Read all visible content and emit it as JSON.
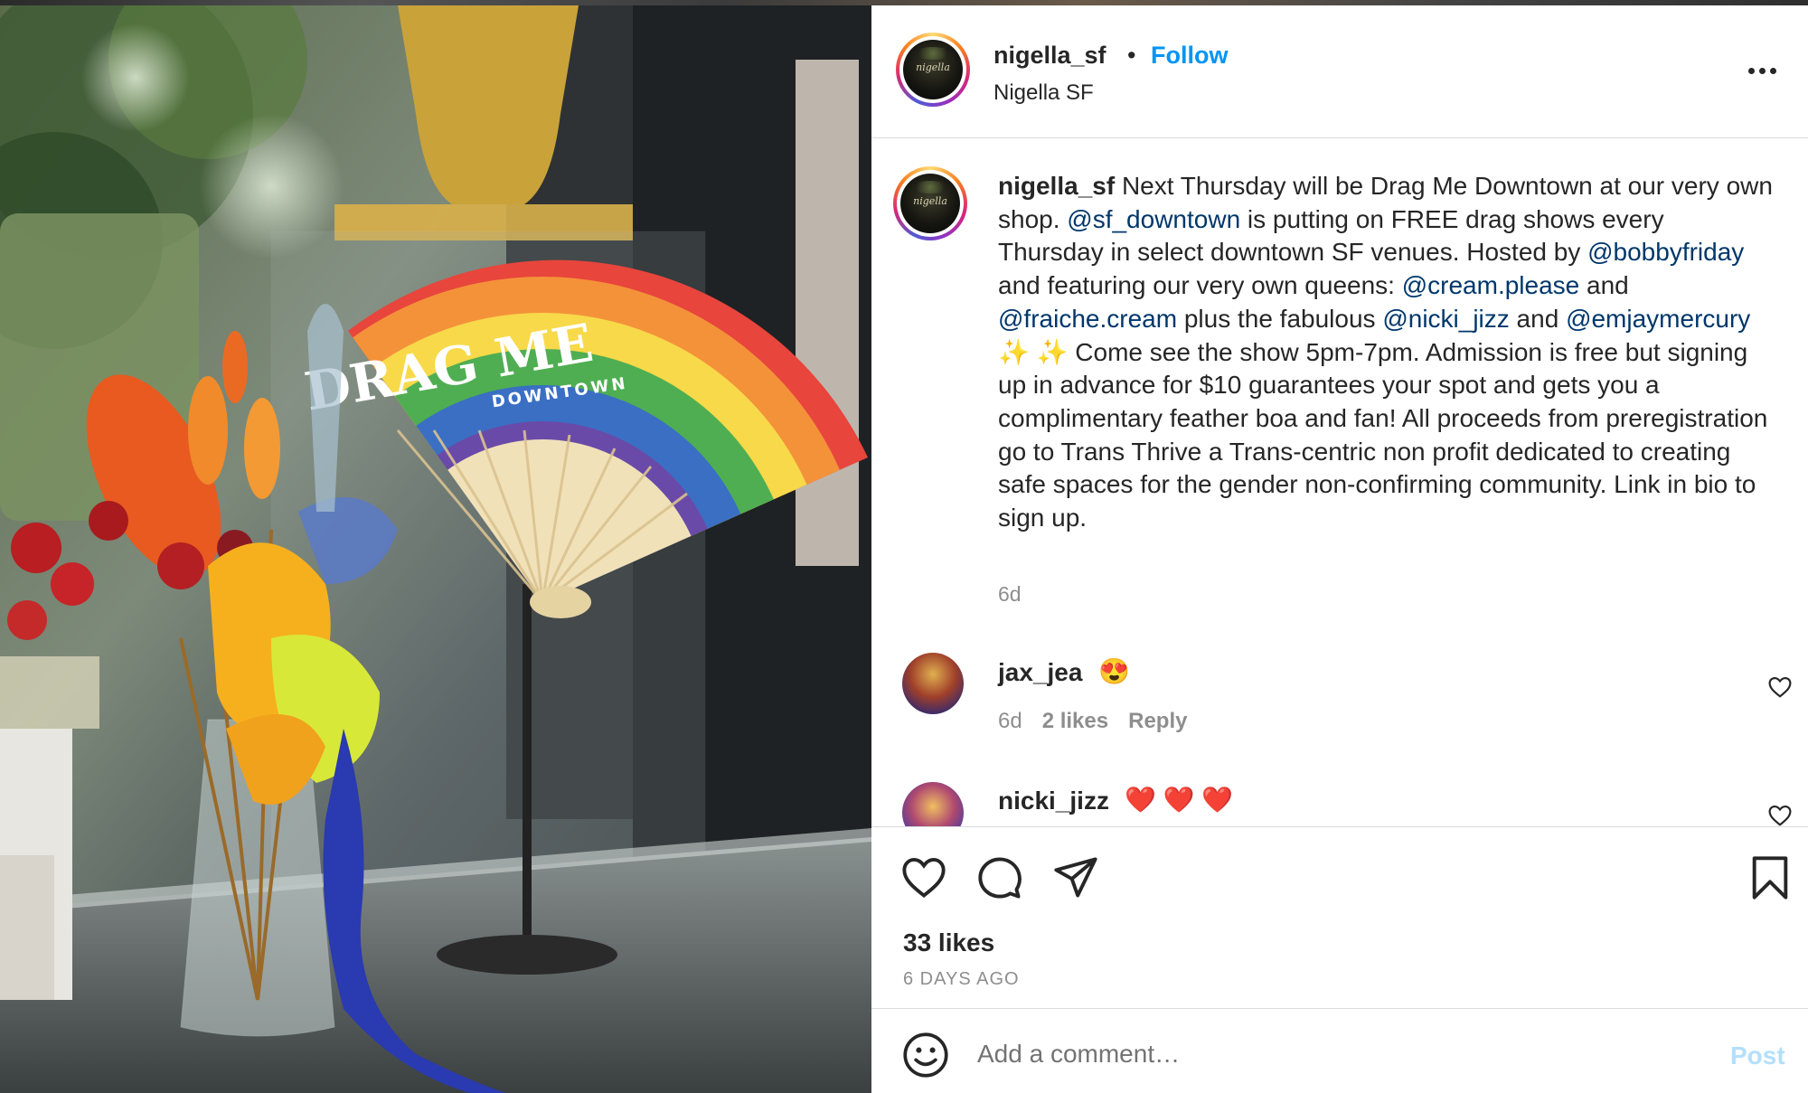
{
  "post": {
    "username": "nigella_sf",
    "follow_label": "Follow",
    "dot": "•",
    "subtitle": "Nigella SF",
    "avatar_text": "nigella"
  },
  "caption": {
    "username": "nigella_sf",
    "parts": [
      {
        "t": " Next Thursday will be Drag Me Downtown at our very own shop. ",
        "m": false
      },
      {
        "t": "@sf_downtown",
        "m": true
      },
      {
        "t": " is putting on FREE drag shows every Thursday in select downtown SF venues. Hosted by ",
        "m": false
      },
      {
        "t": "@bobbyfriday",
        "m": true
      },
      {
        "t": " and featuring our very own queens: ",
        "m": false
      },
      {
        "t": "@cream.please",
        "m": true
      },
      {
        "t": " and ",
        "m": false
      },
      {
        "t": "@fraiche.cream",
        "m": true
      },
      {
        "t": " plus the fabulous ",
        "m": false
      },
      {
        "t": "@nicki_jizz",
        "m": true
      },
      {
        "t": " and ",
        "m": false
      },
      {
        "t": "@emjaymercury",
        "m": true
      },
      {
        "t": " ✨ ✨ Come see the show 5pm-7pm. Admission is free but signing up in advance for $10 guarantees your spot and gets you a complimentary feather boa and fan! All proceeds from preregistration go to Trans Thrive a Trans-centric non profit dedicated to creating safe spaces for the gender non-confirming community. Link in bio to sign up.",
        "m": false
      }
    ],
    "time": "6d"
  },
  "comments": [
    {
      "username": "jax_jea",
      "text": "😍",
      "time": "6d",
      "likes": "2 likes",
      "reply": "Reply"
    },
    {
      "username": "nicki_jizz",
      "text": "❤️ ❤️ ❤️"
    }
  ],
  "stats": {
    "likes": "33 likes",
    "date": "6 DAYS AGO"
  },
  "compose": {
    "placeholder": "Add a comment…",
    "post_label": "Post"
  },
  "photo": {
    "fan_text": "DRAG ME",
    "fan_subtext": "DOWNTOWN",
    "fan_colors": [
      "#e8453c",
      "#f4923a",
      "#f7d94a",
      "#4fae52",
      "#3a6fc4",
      "#6a4aa8"
    ]
  }
}
